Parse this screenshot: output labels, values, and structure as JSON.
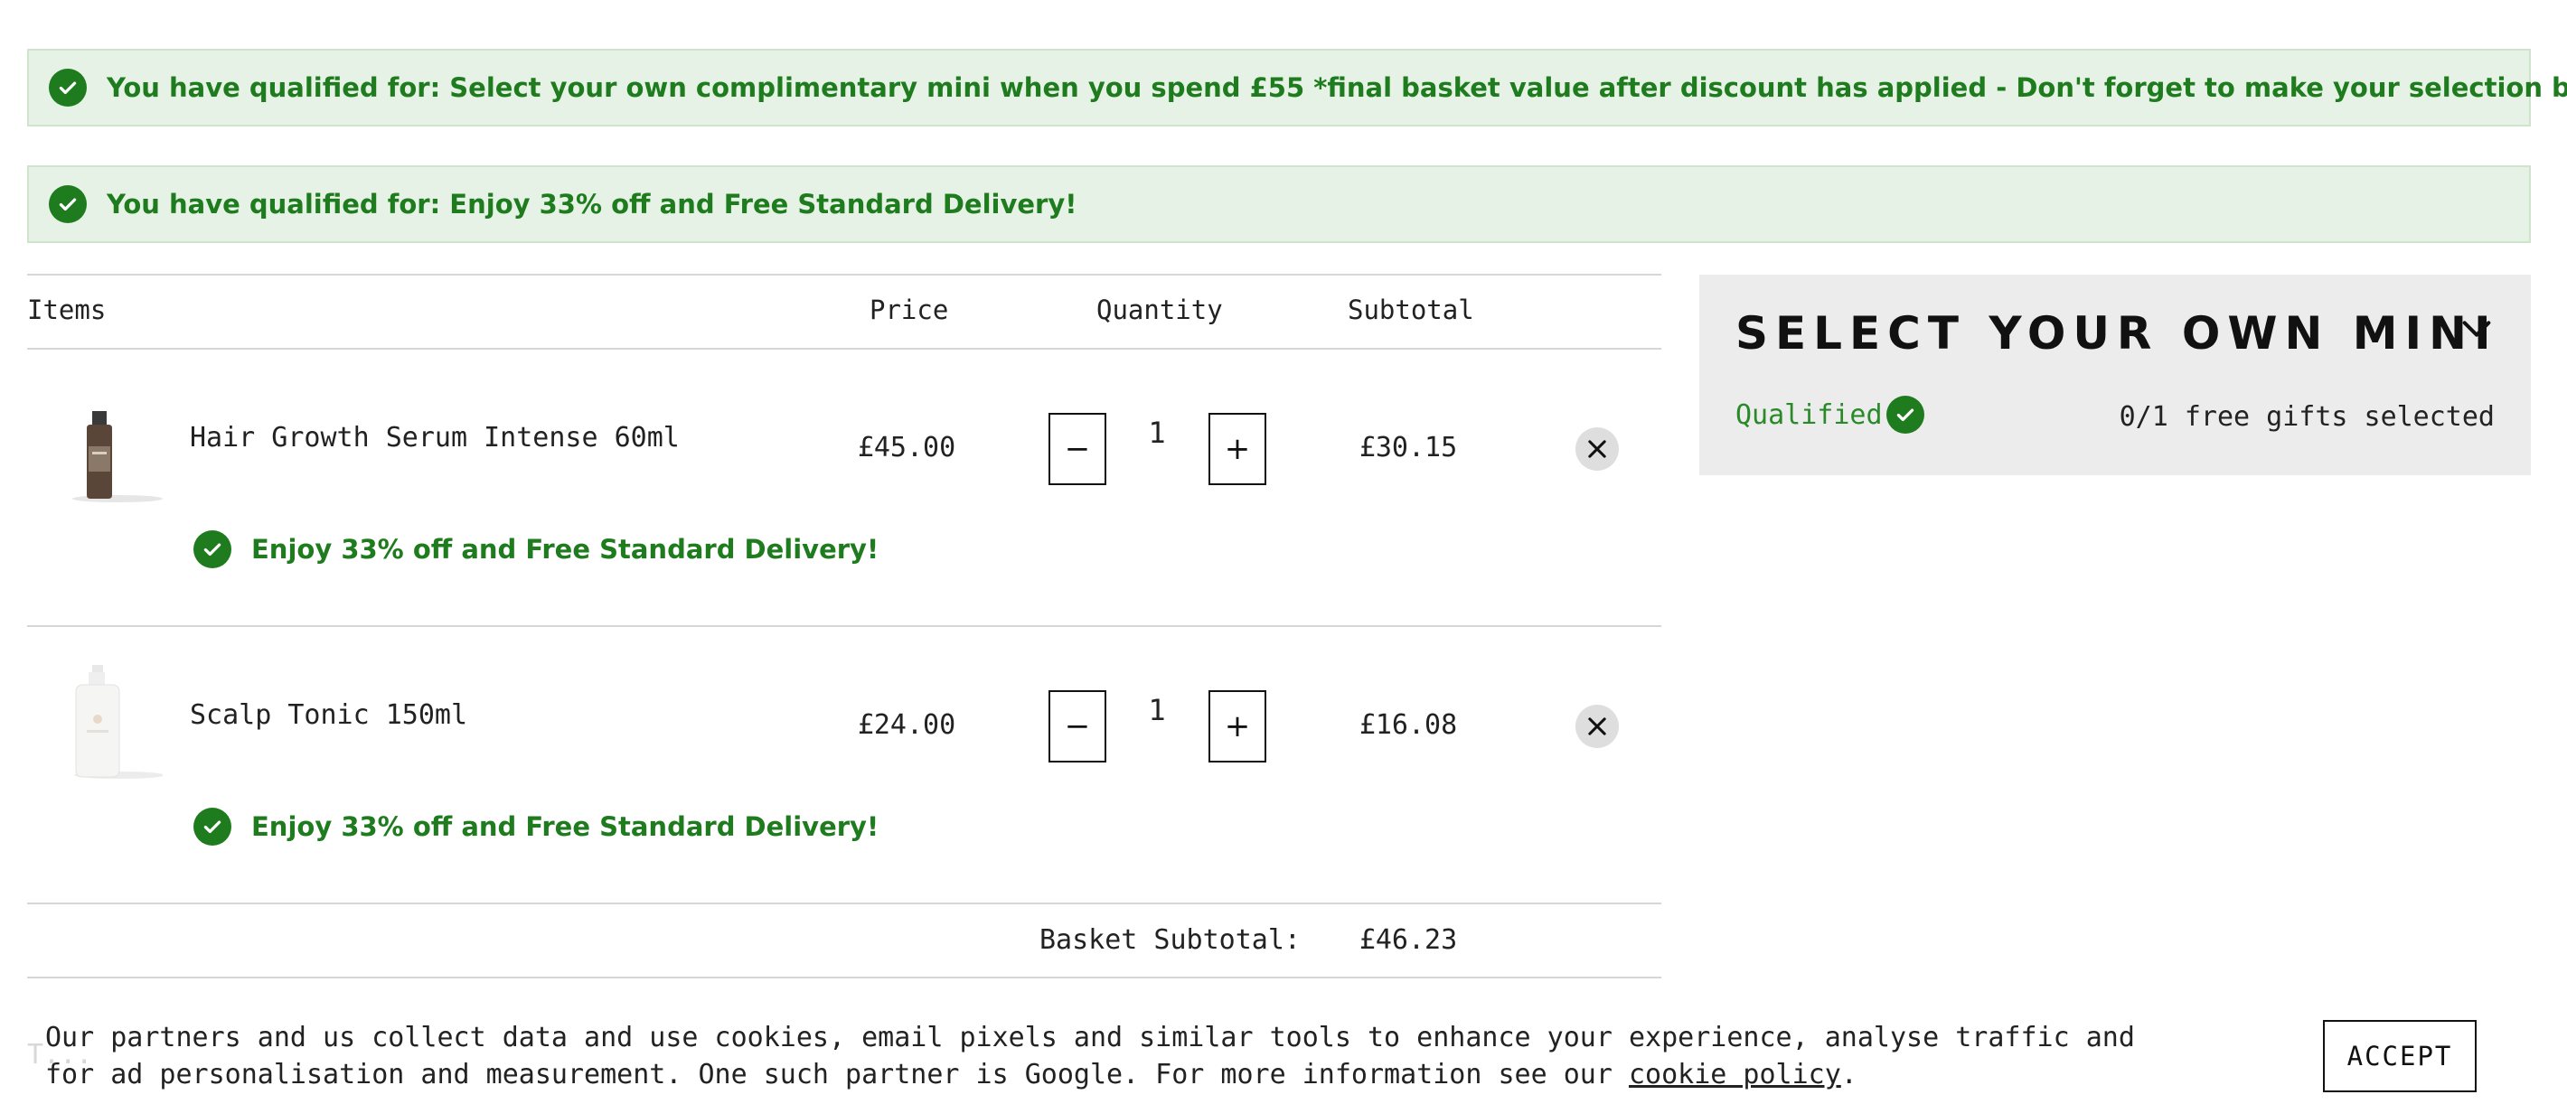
{
  "banners": [
    {
      "text": "You have qualified for: Select your own complimentary mini when you spend £55 *final basket value after discount has applied - Don't forget to make your selection below"
    },
    {
      "text": "You have qualified for: Enjoy 33% off and Free Standard Delivery!"
    }
  ],
  "table": {
    "headers": {
      "items": "Items",
      "price": "Price",
      "quantity": "Quantity",
      "subtotal": "Subtotal"
    }
  },
  "items": [
    {
      "name": "Hair Growth Serum Intense 60ml",
      "price": "£45.00",
      "quantity": "1",
      "subtotal": "£30.15",
      "promo": "Enjoy 33% off and Free Standard Delivery!"
    },
    {
      "name": "Scalp Tonic 150ml",
      "price": "£24.00",
      "quantity": "1",
      "subtotal": "£16.08",
      "promo": "Enjoy 33% off and Free Standard Delivery!"
    }
  ],
  "qty_controls": {
    "minus": "−",
    "plus": "+"
  },
  "basket": {
    "label": "Basket Subtotal:",
    "value": "£46.23"
  },
  "mini_panel": {
    "title": "SELECT YOUR OWN MINI",
    "status": "Qualified",
    "gifts": "0/1 free gifts selected"
  },
  "cookie": {
    "ghost_text": "T...",
    "text": "Our partners and us collect data and use cookies, email pixels and similar tools to enhance your experience, analyse traffic and for ad personalisation and measurement. One such partner is Google. For more information see our",
    "link": "cookie policy",
    "end": ".",
    "accept": "ACCEPT"
  },
  "colors": {
    "accent_green": "#1e7c1e",
    "banner_bg": "#e6f2e5",
    "panel_bg": "#ececec"
  }
}
